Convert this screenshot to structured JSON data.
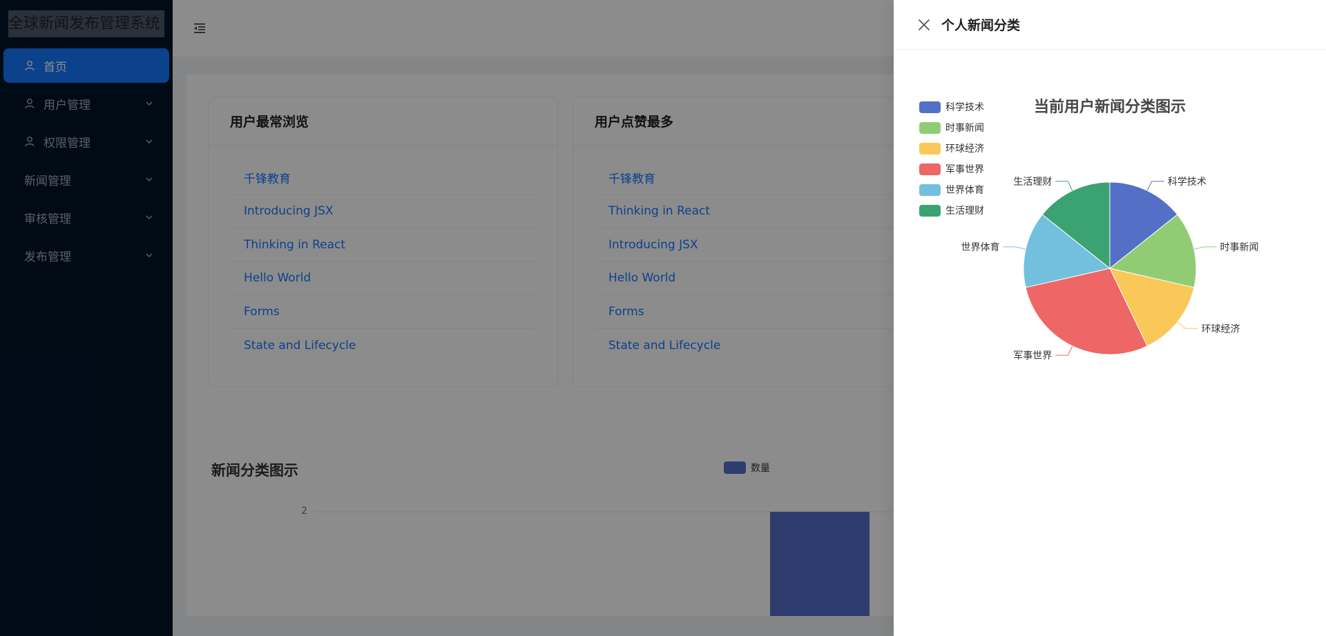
{
  "app": {
    "title": "全球新闻发布管理系统"
  },
  "sidebar": {
    "items": [
      {
        "label": "首页",
        "icon": "user-icon",
        "active": true,
        "expandable": false
      },
      {
        "label": "用户管理",
        "icon": "user-icon",
        "active": false,
        "expandable": true
      },
      {
        "label": "权限管理",
        "icon": "user-icon",
        "active": false,
        "expandable": true
      },
      {
        "label": "新闻管理",
        "icon": "",
        "active": false,
        "expandable": true
      },
      {
        "label": "审核管理",
        "icon": "",
        "active": false,
        "expandable": true
      },
      {
        "label": "发布管理",
        "icon": "",
        "active": false,
        "expandable": true
      }
    ]
  },
  "header": {
    "toggle_icon": "menu-fold-icon"
  },
  "cards": [
    {
      "title": "用户最常浏览",
      "items": [
        "千锋教育",
        "Introducing JSX",
        "Thinking in React",
        "Hello World",
        "Forms",
        "State and Lifecycle"
      ]
    },
    {
      "title": "用户点赞最多",
      "items": [
        "千锋教育",
        "Thinking in React",
        "Introducing JSX",
        "Hello World",
        "Forms",
        "State and Lifecycle"
      ]
    }
  ],
  "bar_chart": {
    "title": "新闻分类图示",
    "legend": "数量",
    "tick_label": "2",
    "color": "#5470c6"
  },
  "drawer": {
    "title": "个人新闻分类",
    "close_icon": "close-icon"
  },
  "chart_data": [
    {
      "type": "pie",
      "title": "当前用户新闻分类图示",
      "legend_position": "top-left",
      "slices": [
        {
          "name": "科学技术",
          "value": 1,
          "color": "#5470c6"
        },
        {
          "name": "时事新闻",
          "value": 1,
          "color": "#91cc75"
        },
        {
          "name": "环球经济",
          "value": 1,
          "color": "#fac858"
        },
        {
          "name": "军事世界",
          "value": 2,
          "color": "#ee6666"
        },
        {
          "name": "世界体育",
          "value": 1,
          "color": "#73c0de"
        },
        {
          "name": "生活理财",
          "value": 1,
          "color": "#3ba272"
        }
      ]
    }
  ]
}
